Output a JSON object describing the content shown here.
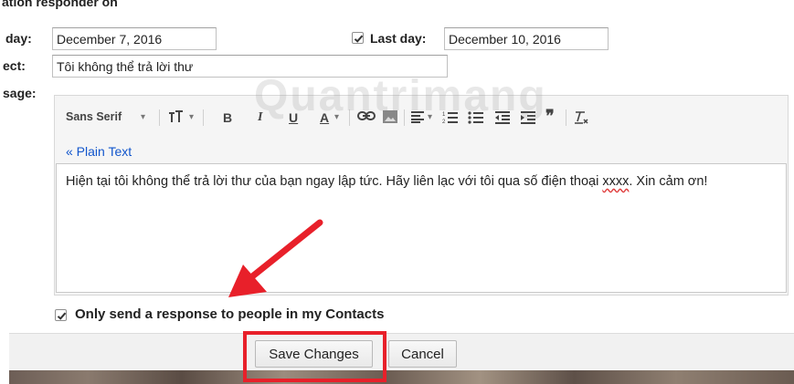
{
  "vacation": {
    "heading_fragment": "ation responder on",
    "first_day_label": "day:",
    "first_day_value": "December 7, 2016",
    "last_day_label": "Last day:",
    "last_day_value": "December 10, 2016",
    "last_day_checked": true,
    "subject_label": "ect:",
    "subject_value": "Tôi không thể trả lời thư",
    "message_label": "sage:"
  },
  "toolbar": {
    "font_label": "Sans Serif",
    "font_dropdown": "▾",
    "icons": [
      "text-size-icon",
      "bold-icon",
      "italic-icon",
      "underline-icon",
      "text-color-icon",
      "link-icon",
      "image-icon",
      "align-icon",
      "numbered-list-icon",
      "bulleted-list-icon",
      "indent-less-icon",
      "indent-more-icon",
      "quote-icon",
      "remove-formatting-icon"
    ]
  },
  "editor": {
    "plain_text_link": "« Plain Text",
    "message_part1": "Hiện tại tôi không thể trả lời thư của bạn ngay lập tức. Hãy liên lạc với tôi qua số điện thoại ",
    "message_squiggle": "xxxx",
    "message_part2": ". Xin cảm ơn!"
  },
  "contacts_only": {
    "label": "Only send a response to people in my Contacts",
    "checked": true
  },
  "buttons": {
    "save": "Save Changes",
    "cancel": "Cancel"
  },
  "watermark": "Quantrimang",
  "colors": {
    "link": "#1155cc",
    "highlight": "#e8202a",
    "arrow": "#e8202a"
  }
}
